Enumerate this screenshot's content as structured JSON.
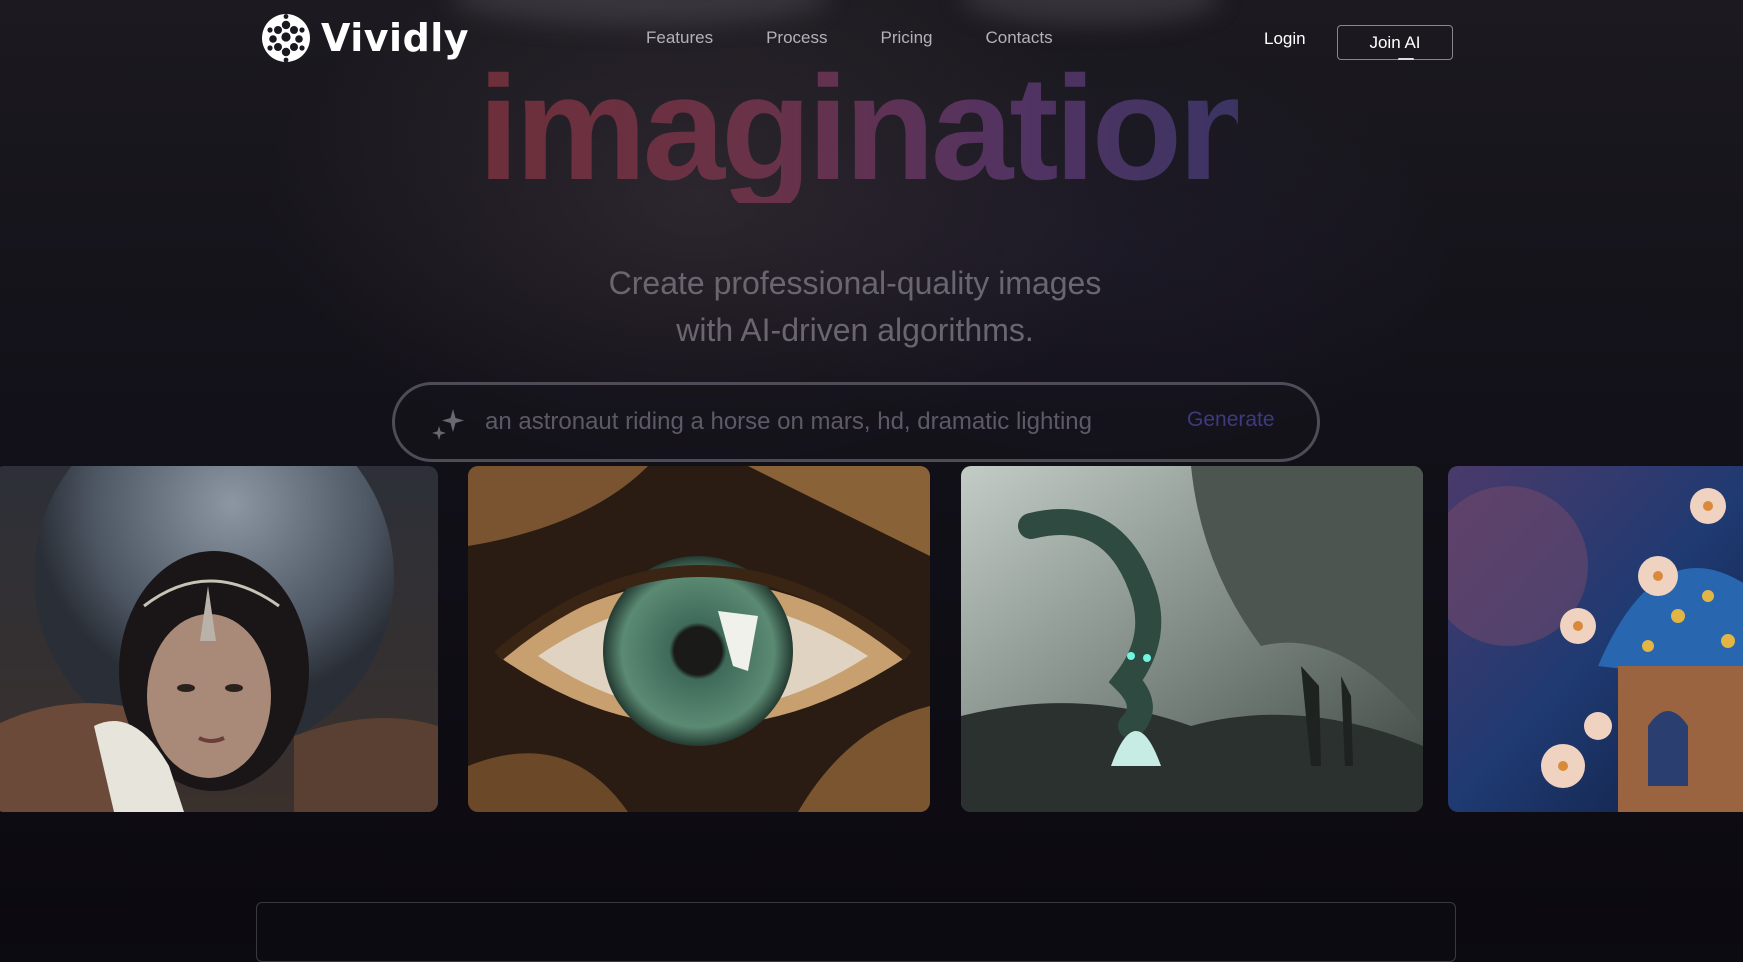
{
  "brand": {
    "name": "Vividly"
  },
  "nav": {
    "items": [
      {
        "label": "Features"
      },
      {
        "label": "Process"
      },
      {
        "label": "Pricing"
      },
      {
        "label": "Contacts"
      }
    ],
    "login_label": "Login",
    "join_label": "Join AI"
  },
  "hero": {
    "headline": "imagination.",
    "subtitle_line1": "Create professional-quality images",
    "subtitle_line2": "with AI-driven algorithms."
  },
  "prompt": {
    "value": "an astronaut riding a horse on mars, hd, dramatic lighting",
    "generate_label": "Generate",
    "icon": "sparkle-icon"
  },
  "gallery": {
    "images": [
      {
        "subject": "woman-with-headdress-and-moon"
      },
      {
        "subject": "close-up-eye-with-leaves"
      },
      {
        "subject": "dragon-over-stormy-sea"
      },
      {
        "subject": "fantasy-flower-house-night-sky"
      }
    ]
  },
  "colors": {
    "background": "#0d0b12",
    "headline_start": "#6d2f3a",
    "headline_end": "#3b3463",
    "generate": "#3e3a80"
  }
}
